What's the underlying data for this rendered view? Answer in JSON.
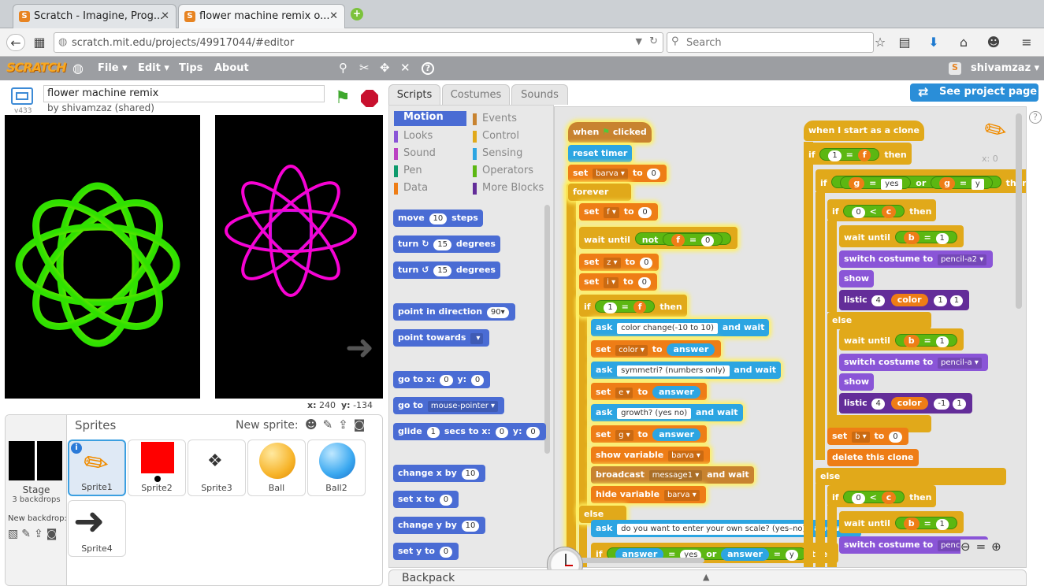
{
  "browser": {
    "tabs": [
      {
        "title": "Scratch - Imagine, Prog...",
        "active": false
      },
      {
        "title": "flower machine remix o...",
        "active": true
      }
    ],
    "url": "scratch.mit.edu/projects/49917044/#editor",
    "search_placeholder": "Search"
  },
  "menubar": {
    "logo": "SCRATCH",
    "items": [
      "File ▾",
      "Edit ▾",
      "Tips",
      "About"
    ],
    "user": "shivamzaz ▾"
  },
  "stage": {
    "version": "v433",
    "project_title": "flower machine remix",
    "author": "by shivamzaz (shared)",
    "x_label": "x:",
    "x_value": "240",
    "y_label": "y:",
    "y_value": "-134"
  },
  "sprites": {
    "header": "Sprites",
    "new_sprite": "New sprite:",
    "stage_label": "Stage",
    "stage_backdrops": "3 backdrops",
    "new_backdrop": "New backdrop:",
    "items": [
      "Sprite1",
      "Sprite2",
      "Sprite3",
      "Ball",
      "Ball2",
      "Sprite4"
    ]
  },
  "editor_tabs": [
    "Scripts",
    "Costumes",
    "Sounds"
  ],
  "see_project": "See project page",
  "categories": [
    {
      "name": "Motion",
      "color": "#4a6cd4"
    },
    {
      "name": "Events",
      "color": "#c88330"
    },
    {
      "name": "Looks",
      "color": "#8a55d7"
    },
    {
      "name": "Control",
      "color": "#e1a91a"
    },
    {
      "name": "Sound",
      "color": "#bb42c3"
    },
    {
      "name": "Sensing",
      "color": "#2ca5e2"
    },
    {
      "name": "Pen",
      "color": "#0e9a6c"
    },
    {
      "name": "Operators",
      "color": "#5cb712"
    },
    {
      "name": "Data",
      "color": "#ee7d16"
    },
    {
      "name": "More Blocks",
      "color": "#632d99"
    }
  ],
  "palette": {
    "move": "move",
    "move_n": "10",
    "steps": "steps",
    "turn": "turn",
    "turn_n": "15",
    "degrees": "degrees",
    "point_dir": "point in direction",
    "dir_n": "90▾",
    "point_towards": "point towards",
    "goto_xy": "go to x:",
    "gx": "0",
    "y": "y:",
    "gy": "0",
    "goto": "go to",
    "mouse": "mouse-pointer ▾",
    "glide": "glide",
    "glide_n": "1",
    "secs_to_x": "secs to x:",
    "glx": "0",
    "gly": "0",
    "change_x": "change x by",
    "cx": "10",
    "set_x": "set x to",
    "sx": "0",
    "change_y": "change y by",
    "cy": "10",
    "set_y": "set y to",
    "sy": "0"
  },
  "script1": {
    "when_flag": "when",
    "clicked": "clicked",
    "reset_timer": "reset timer",
    "set": "set",
    "to": "to",
    "barva": "barva ▾",
    "zero": "0",
    "forever": "forever",
    "f": "f ▾",
    "wait_until": "wait until",
    "not": "not",
    "fvar": "f",
    "eq": "=",
    "z": "z ▾",
    "i": "i ▾",
    "if": "if",
    "one": "1",
    "then": "then",
    "ask": "ask",
    "and_wait": "and wait",
    "q1": "color change(-10 to 10)",
    "color": "color ▾",
    "answer": "answer",
    "q2": "symmetri? (numbers only)",
    "e": "e ▾",
    "q3": "growth? (yes no)",
    "g": "g ▾",
    "show_variable": "show variable",
    "barva_v": "barva ▾",
    "broadcast": "broadcast",
    "message1": "message1 ▾",
    "hide_variable": "hide variable",
    "else": "else",
    "q4": "do you want to enter your own scale? (yes–no)",
    "or": "or",
    "yes": "yes",
    "y": "y"
  },
  "script2": {
    "when_clone": "when I start as a clone",
    "if": "if",
    "one": "1",
    "eq": "=",
    "f": "f",
    "then": "then",
    "g": "g",
    "yes": "yes",
    "or": "or",
    "y": "y",
    "zero": "0",
    "lt": "<",
    "c": "c",
    "wait_until": "wait until",
    "b": "b",
    "switch_costume": "switch costume to",
    "pencil_a2": "pencil-a2 ▾",
    "pencil_a": "pencil-a ▾",
    "show": "show",
    "listic": "listic",
    "four": "4",
    "color": "color",
    "neg1": "-1",
    "else": "else",
    "set": "set",
    "bvar": "b ▾",
    "to": "to",
    "delete_clone": "delete this clone"
  },
  "xy_readout": "x: 0",
  "backpack": "Backpack"
}
